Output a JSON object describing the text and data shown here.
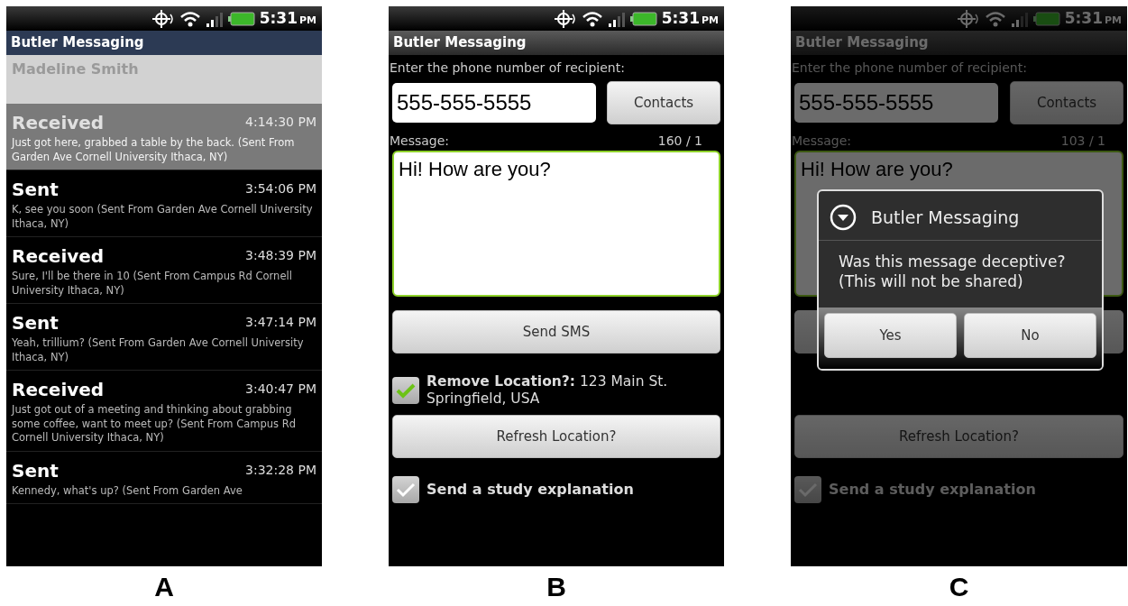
{
  "panels": [
    {
      "label": "A",
      "screen": {
        "kind": "inbox",
        "status": {
          "time": "5:31",
          "ampm": "PM"
        },
        "app_title": "Butler Messaging",
        "contact_name": "Madeline Smith",
        "messages": [
          {
            "direction": "Received",
            "time": "4:14:30 PM",
            "body": "Just got here, grabbed a table by the back. (Sent From Garden Ave Cornell University Ithaca, NY)",
            "selected": true
          },
          {
            "direction": "Sent",
            "time": "3:54:06 PM",
            "body": "K, see you soon (Sent From Garden Ave Cornell University Ithaca, NY)",
            "selected": false
          },
          {
            "direction": "Received",
            "time": "3:48:39 PM",
            "body": "Sure, I'll be there in 10 (Sent From Campus Rd Cornell University Ithaca, NY)",
            "selected": false
          },
          {
            "direction": "Sent",
            "time": "3:47:14 PM",
            "body": "Yeah, trillium? (Sent From Garden Ave Cornell University Ithaca, NY)",
            "selected": false
          },
          {
            "direction": "Received",
            "time": "3:40:47 PM",
            "body": "Just got out of a meeting and thinking about grabbing some coffee, want to meet up? (Sent From Campus Rd Cornell University Ithaca, NY)",
            "selected": false
          },
          {
            "direction": "Sent",
            "time": "3:32:28 PM",
            "body": "Kennedy, what's up? (Sent From Garden Ave",
            "selected": false
          }
        ]
      }
    },
    {
      "label": "B",
      "screen": {
        "kind": "compose",
        "status": {
          "time": "5:31",
          "ampm": "PM"
        },
        "app_title": "Butler Messaging",
        "recipient_label": "Enter the phone number of recipient:",
        "phone_value": "555-555-5555",
        "contacts_button": "Contacts",
        "message_label": "Message:",
        "counter": "160 / 1",
        "message_value": "Hi! How are you?",
        "send_button": "Send SMS",
        "remove_location": {
          "text": "**Remove Location?:** 123 Main St. Springfield, USA",
          "checked": true
        },
        "refresh_button": "Refresh Location?",
        "study": {
          "label": "Send a study explanation",
          "checked": false
        }
      }
    },
    {
      "label": "C",
      "screen": {
        "kind": "compose_dialog",
        "status": {
          "time": "5:31",
          "ampm": "PM"
        },
        "app_title": "Butler Messaging",
        "recipient_label": "Enter the phone number of recipient:",
        "phone_value": "555-555-5555",
        "contacts_button": "Contacts",
        "message_label": "Message:",
        "counter": "103 / 1",
        "message_value": "Hi! How are you?",
        "refresh_button": "Refresh Location?",
        "study": {
          "label": "Send a study explanation",
          "checked": false
        },
        "dialog": {
          "title": "Butler Messaging",
          "message": "Was this message deceptive?\n(This will not be shared)",
          "buttons": [
            "Yes",
            "No"
          ]
        }
      }
    }
  ]
}
